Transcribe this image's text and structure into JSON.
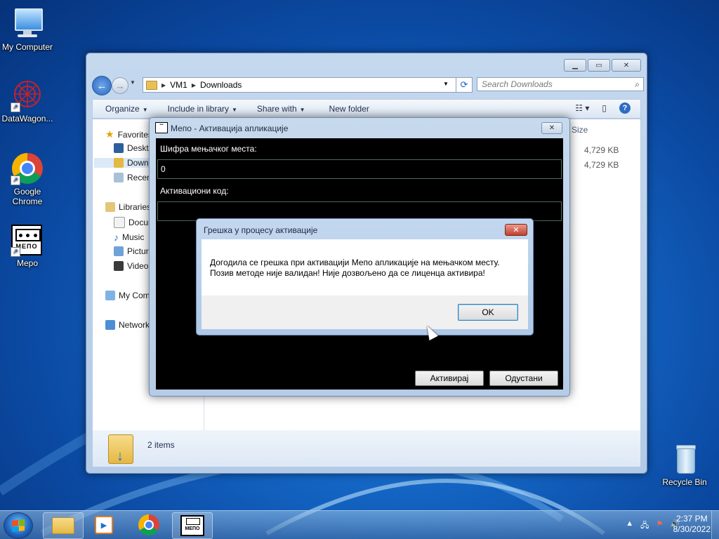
{
  "desktop": {
    "icons": [
      {
        "label": "My Computer"
      },
      {
        "label": "DataWagon..."
      },
      {
        "label": "Google Chrome"
      },
      {
        "label": "Mepo"
      },
      {
        "label": "Recycle Bin"
      }
    ],
    "mepo_logo_text": "МЕПО"
  },
  "explorer": {
    "breadcrumb": [
      "VM1",
      "Downloads"
    ],
    "search_placeholder": "Search Downloads",
    "toolbar": {
      "organize": "Organize",
      "include": "Include in library",
      "share": "Share with",
      "new_folder": "New folder"
    },
    "nav": {
      "favorites": "Favorites",
      "desktop": "Desktop",
      "downloads": "Downloads",
      "recent": "Recent Places",
      "libraries": "Libraries",
      "documents": "Documents",
      "music": "Music",
      "pictures": "Pictures",
      "videos": "Videos",
      "computer": "My Computer",
      "network": "Network"
    },
    "column_size": "Size",
    "files": [
      {
        "size": "4,729 KB"
      },
      {
        "size": "4,729 KB"
      }
    ],
    "item_count": "2 items"
  },
  "mepo": {
    "title": "Мепо - Активација апликације",
    "label_station": "Шифра мењачког места:",
    "station_value": "0",
    "label_code": "Активациони код:",
    "code_value": "",
    "activate": "Активирај",
    "cancel": "Одустани"
  },
  "dialog": {
    "title": "Грешка у процесу активације",
    "line1": "Догодила се грешка при активацији Мепо апликације на мењачком месту.",
    "line2": "Позив методе није валидан! Није дозвољено да се лиценца активира!",
    "ok": "OK"
  },
  "taskbar": {
    "time": "2:37 PM",
    "date": "8/30/2022",
    "mepo_label": "МЕПО"
  },
  "colors": {
    "desktop_bg": "#1466c5",
    "mepo_body": "#000000",
    "dialog_close": "#c3402d"
  }
}
